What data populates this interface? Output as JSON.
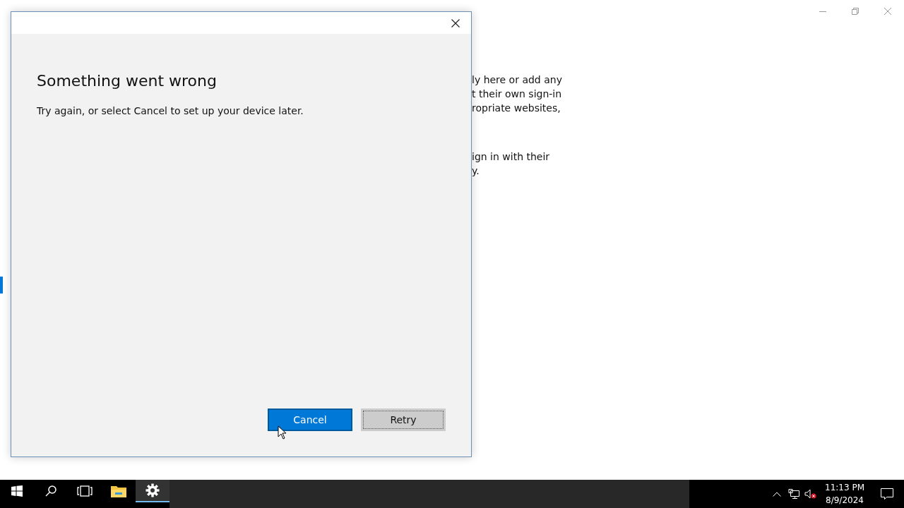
{
  "settings_window": {
    "paragraphs": [
      [
        "ly here or add any",
        "t their own sign-in",
        "ropriate websites,"
      ],
      [
        "ign in with their",
        "y."
      ]
    ]
  },
  "dialog": {
    "heading": "Something went wrong",
    "message": "Try again, or select Cancel to set up your device later.",
    "buttons": [
      {
        "label": "Cancel",
        "kind": "primary",
        "focused": false
      },
      {
        "label": "Retry",
        "kind": "secondary",
        "focused": true
      }
    ]
  },
  "taskbar": {
    "apps": [
      {
        "kind": "start",
        "active": false
      },
      {
        "kind": "search",
        "active": false
      },
      {
        "kind": "task-view",
        "active": false
      },
      {
        "kind": "file-explorer",
        "active": false
      },
      {
        "kind": "settings",
        "active": true
      }
    ],
    "time": "11:13 PM",
    "date": "8/9/2024"
  }
}
